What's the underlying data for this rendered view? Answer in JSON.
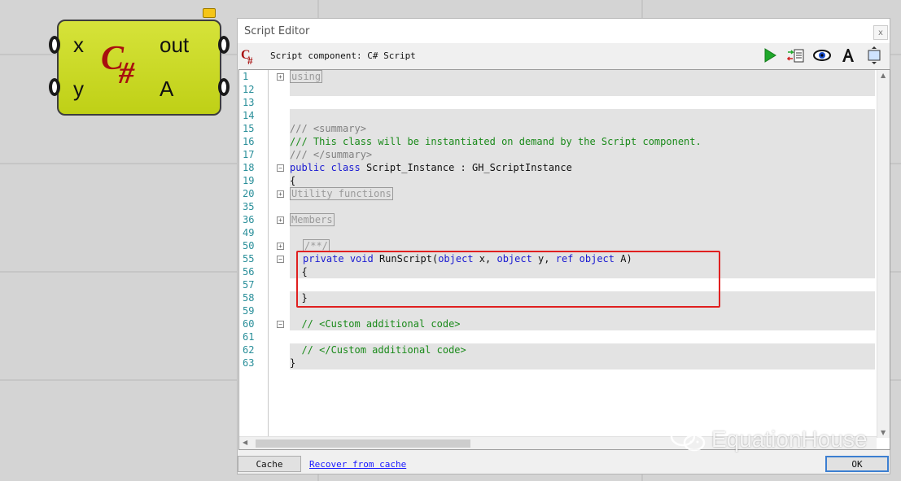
{
  "component": {
    "inputs": [
      "x",
      "y"
    ],
    "outputs": [
      "out",
      "A"
    ],
    "logo_text": "C",
    "logo_hash": "#"
  },
  "editor": {
    "title": "Script Editor",
    "close_label": "x",
    "header_text": "Script component: C# Script",
    "toolbar_icons": [
      "run-icon",
      "insert-code-icon",
      "preview-icon",
      "font-icon",
      "fit-window-icon"
    ],
    "lines": [
      {
        "n": "1",
        "text": "using",
        "type": "collapsed",
        "fold": "+",
        "band": "gray"
      },
      {
        "n": "12",
        "text": "",
        "band": "gray"
      },
      {
        "n": "13",
        "text": "",
        "band": "white"
      },
      {
        "n": "14",
        "text": "",
        "band": "gray"
      },
      {
        "n": "15",
        "text": "/// <summary>",
        "type": "comment-gray",
        "band": "gray"
      },
      {
        "n": "16",
        "text": "/// This class will be instantiated on demand by the Script component.",
        "type": "comment",
        "band": "gray"
      },
      {
        "n": "17",
        "text": "/// </summary>",
        "type": "comment-gray",
        "band": "gray"
      },
      {
        "n": "18",
        "text": "public class Script_Instance : GH_ScriptInstance",
        "type": "class",
        "fold": "-",
        "band": "gray"
      },
      {
        "n": "19",
        "text": "{",
        "band": "gray"
      },
      {
        "n": "20",
        "text": "Utility functions",
        "type": "collapsed",
        "fold": "+",
        "band": "gray"
      },
      {
        "n": "35",
        "text": "",
        "band": "gray"
      },
      {
        "n": "36",
        "text": "Members",
        "type": "collapsed",
        "fold": "+",
        "band": "gray"
      },
      {
        "n": "49",
        "text": "",
        "band": "gray"
      },
      {
        "n": "50",
        "text": "/**/",
        "type": "collapsed-indent",
        "fold": "+",
        "band": "gray"
      },
      {
        "n": "55",
        "text": "private void RunScript(object x, object y, ref object A)",
        "type": "method",
        "fold": "-",
        "band": "gray"
      },
      {
        "n": "56",
        "text": "  {",
        "band": "gray"
      },
      {
        "n": "57",
        "text": "",
        "band": "white"
      },
      {
        "n": "58",
        "text": "  }",
        "band": "gray"
      },
      {
        "n": "59",
        "text": "",
        "band": "gray"
      },
      {
        "n": "60",
        "text": "  // <Custom additional code>",
        "type": "comment",
        "fold": "-",
        "band": "gray"
      },
      {
        "n": "61",
        "text": "",
        "band": "white"
      },
      {
        "n": "62",
        "text": "  // </Custom additional code>",
        "type": "comment",
        "band": "gray"
      },
      {
        "n": "63",
        "text": "}",
        "band": "gray"
      }
    ],
    "cache_button": "Cache",
    "recover_link": "Recover from cache",
    "ok_button": "OK"
  },
  "watermark": "EquationHouse"
}
